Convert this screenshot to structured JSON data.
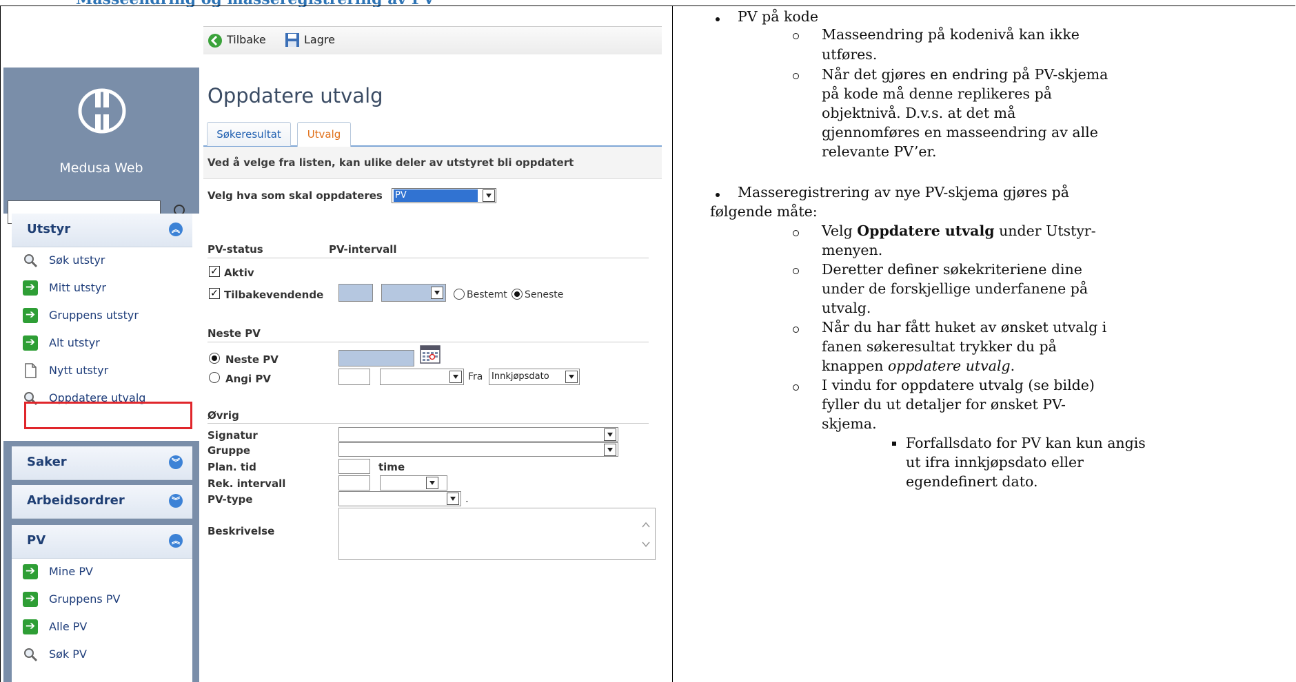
{
  "doc_heading": "Masseendring og masseregistrering av PV",
  "app": {
    "brand": "Medusa Web",
    "search": {
      "value": "",
      "placeholder": ""
    },
    "menus": [
      {
        "title": "Utstyr",
        "items": [
          "Søk utstyr",
          "Mitt utstyr",
          "Gruppens utstyr",
          "Alt utstyr",
          "Nytt utstyr",
          "Oppdatere utvalg"
        ]
      },
      {
        "title": "Saker",
        "items": []
      },
      {
        "title": "Arbeidsordrer",
        "items": []
      },
      {
        "title": "PV",
        "items": [
          "Mine PV",
          "Gruppens PV",
          "Alle PV",
          "Søk PV"
        ]
      }
    ]
  },
  "main": {
    "toolbar": {
      "back": "Tilbake",
      "save": "Lagre"
    },
    "title": "Oppdatere utvalg",
    "tabs": [
      {
        "label": "Søkeresultat",
        "active": false
      },
      {
        "label": "Utvalg",
        "active": true
      }
    ],
    "info": "Ved å velge fra listen, kan ulike deler av utstyret bli oppdatert",
    "select_label": "Velg hva som skal oppdateres",
    "select_value": "PV",
    "status_header": "PV-status",
    "interval_header": "PV-intervall",
    "aktiv_label": "Aktiv",
    "tilbake_label": "Tilbakevendende",
    "bestemt_label": "Bestemt",
    "seneste_label": "Seneste",
    "neste_section": "Neste PV",
    "neste_radio_label": "Neste PV",
    "angi_label": "Angi PV",
    "fra_label": "Fra",
    "fra_value": "Innkjøpsdato",
    "ovrig_section": "Øvrig",
    "signatur_label": "Signatur",
    "gruppe_label": "Gruppe",
    "plan_label": "Plan. tid",
    "time_label": "time",
    "rek_label": "Rek. intervall",
    "pvtype_label": "PV-type",
    "pvtype_suffix": ".",
    "beskrivelse_label": "Beskrivelse"
  },
  "notes": {
    "b1": "PV på kode",
    "b1_sub1": [
      "Masseendring på kodenivå kan ikke",
      "utføres."
    ],
    "b1_sub2": [
      "Når det gjøres en endring på PV-skjema",
      "på kode må denne replikeres på",
      "objektnivå. D.v.s. at det må",
      "gjennomføres en masseendring av alle",
      "relevante PV’er."
    ],
    "b2": [
      "Masseregistrering av nye PV-skjema gjøres på",
      "følgende måte:"
    ],
    "s1_pre": "Velg ",
    "s1_bold": "Oppdatere utvalg",
    "s1_post": " under Utstyr-",
    "s1_line2": "menyen.",
    "s2": [
      "Deretter definer søkekriteriene dine",
      "under de forskjellige underfanene på",
      "utvalg."
    ],
    "s3_l1": "Når du har fått huket av ønsket utvalg i",
    "s3_l2": "fanen søkeresultat trykker du på",
    "s3_l3_pre": "knappen ",
    "s3_l3_it": "oppdatere utvalg",
    "s3_l3_post": ".",
    "s4": [
      "I vindu for oppdatere utvalg (se bilde)",
      "fyller du ut detaljer for ønsket PV-",
      "skjema."
    ],
    "s4_sub": [
      "Forfallsdato for PV kan kun angis",
      "ut ifra innkjøpsdato eller",
      "egendefinert dato."
    ]
  },
  "colors": {
    "sidebar": "#7a8ea9",
    "menu_text": "#1e3d7a",
    "highlight": "#e0262b",
    "tab_active": "#e06f18"
  }
}
